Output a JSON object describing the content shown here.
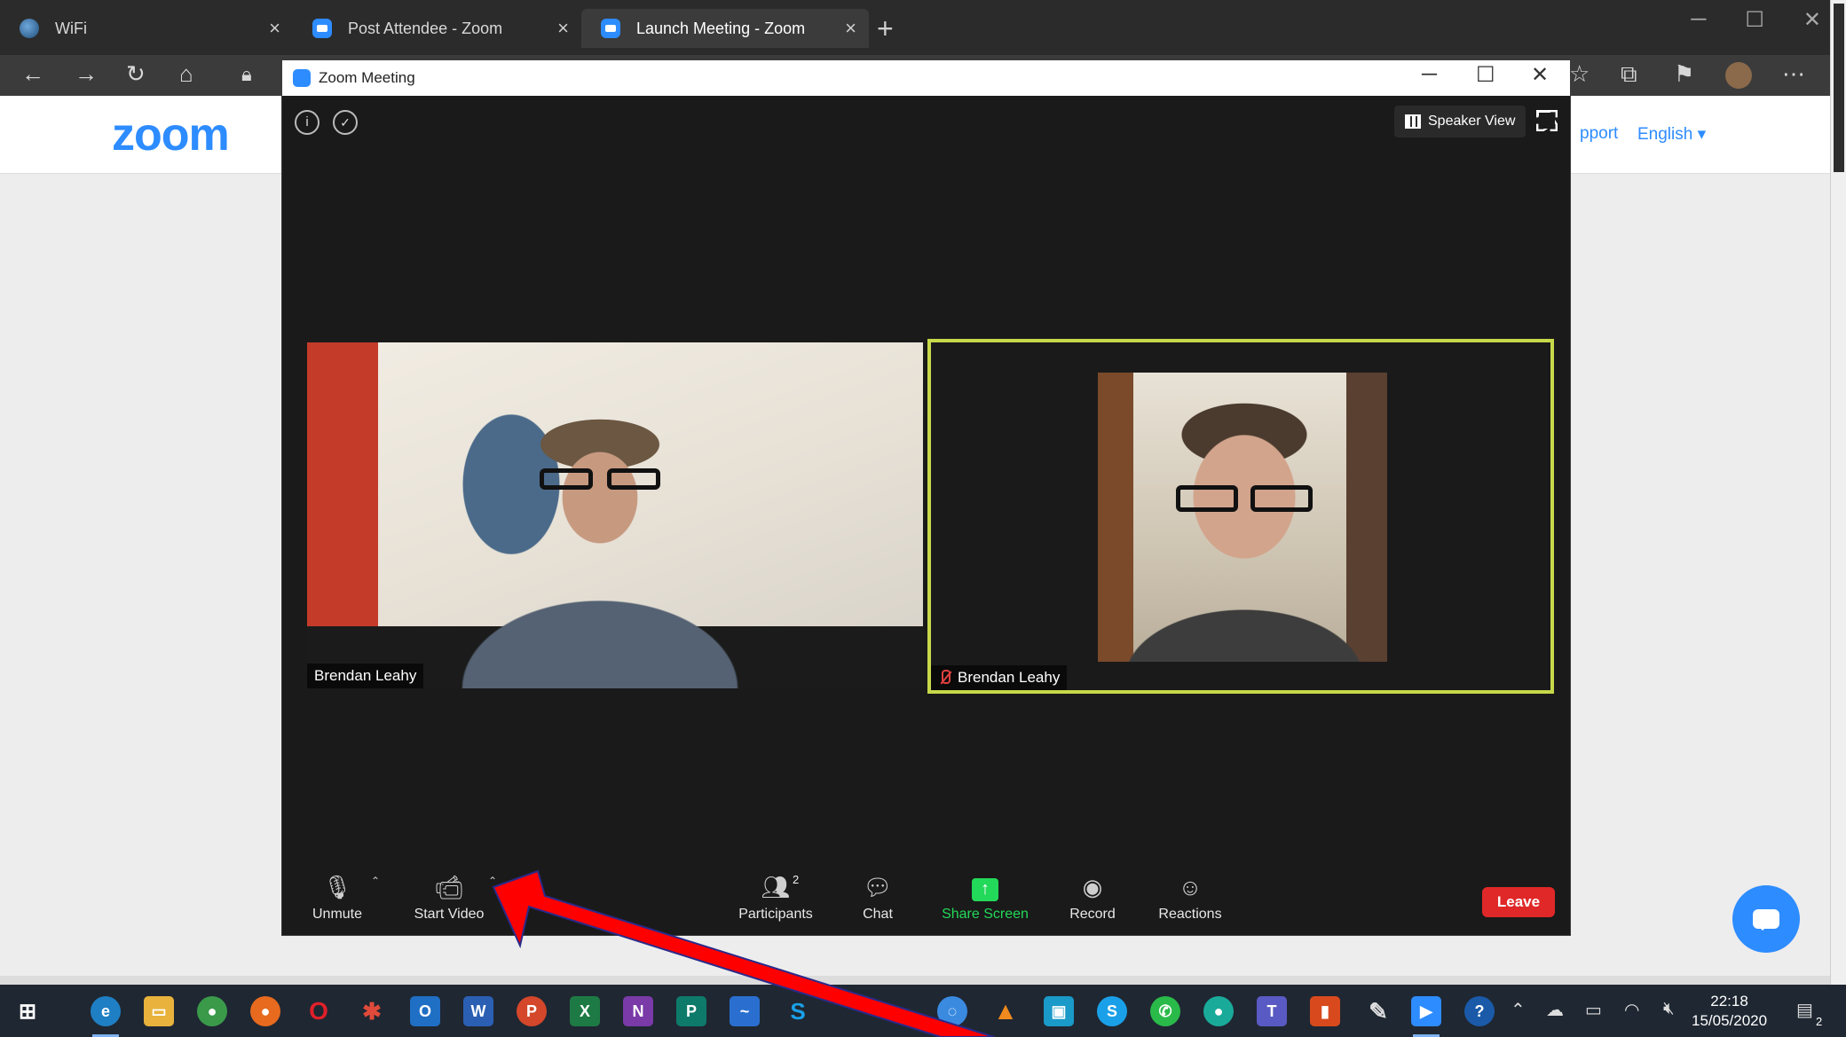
{
  "browser": {
    "tabs": [
      {
        "title": "WiFi",
        "close": "×"
      },
      {
        "title": "Post Attendee - Zoom",
        "close": "×"
      },
      {
        "title": "Launch Meeting - Zoom",
        "close": "×"
      }
    ],
    "new_tab": "+",
    "window_controls": [
      "─",
      "☐",
      "✕"
    ]
  },
  "webpage": {
    "logo": "zoom",
    "support_link": "pport",
    "language": "English ▾"
  },
  "meeting": {
    "window_title": "Zoom Meeting",
    "window_controls": [
      "─",
      "☐",
      "✕"
    ],
    "info_icon": "i",
    "view_button": "Speaker View",
    "participants_tiles": [
      {
        "name": "Brendan Leahy",
        "muted": false
      },
      {
        "name": "Brendan Leahy",
        "muted": true,
        "active_speaker": true
      }
    ],
    "controls": {
      "unmute": "Unmute",
      "start_video": "Start Video",
      "participants": "Participants",
      "participants_count": "2",
      "chat": "Chat",
      "share_screen": "Share Screen",
      "record": "Record",
      "reactions": "Reactions",
      "leave": "Leave"
    },
    "colors": {
      "accent": "#2d8cff",
      "share": "#23d959",
      "leave": "#e02828",
      "active_border": "#c7d94a"
    }
  },
  "taskbar": {
    "time": "22:18",
    "date": "15/05/2020",
    "notification_count": "2"
  },
  "annotation": {
    "arrow_color": "#ff0000"
  }
}
